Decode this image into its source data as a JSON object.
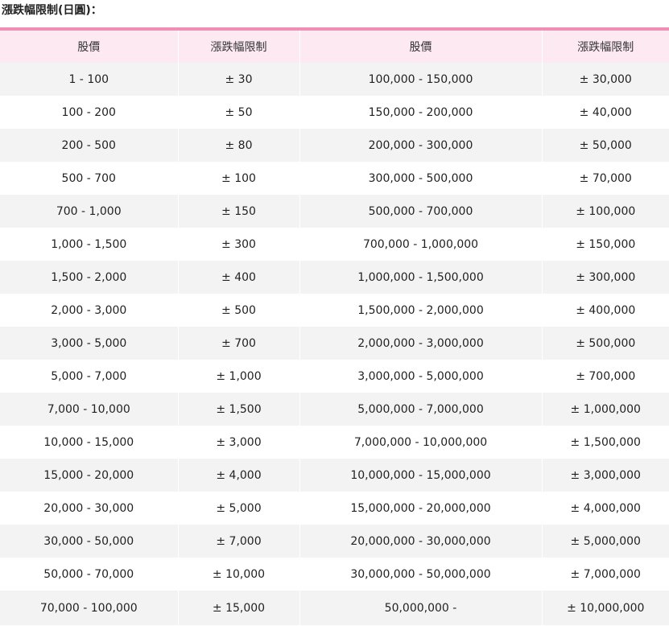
{
  "page_title": "漲跌幅限制(日圓)：",
  "table": {
    "headers": [
      "股價",
      "漲跌幅限制",
      "股價",
      "漲跌幅限制"
    ],
    "rows": [
      [
        "1 - 100",
        "± 30",
        "100,000 - 150,000",
        "± 30,000"
      ],
      [
        "100 - 200",
        "± 50",
        "150,000 - 200,000",
        "± 40,000"
      ],
      [
        "200 - 500",
        "± 80",
        "200,000 - 300,000",
        "± 50,000"
      ],
      [
        "500 - 700",
        "± 100",
        "300,000 - 500,000",
        "± 70,000"
      ],
      [
        "700 - 1,000",
        "± 150",
        "500,000 - 700,000",
        "± 100,000"
      ],
      [
        "1,000 - 1,500",
        "± 300",
        "700,000 - 1,000,000",
        "± 150,000"
      ],
      [
        "1,500 - 2,000",
        "± 400",
        "1,000,000 - 1,500,000",
        "± 300,000"
      ],
      [
        "2,000 - 3,000",
        "± 500",
        "1,500,000 - 2,000,000",
        "± 400,000"
      ],
      [
        "3,000 - 5,000",
        "± 700",
        "2,000,000 - 3,000,000",
        "± 500,000"
      ],
      [
        "5,000 - 7,000",
        "± 1,000",
        "3,000,000 - 5,000,000",
        "± 700,000"
      ],
      [
        "7,000 - 10,000",
        "± 1,500",
        "5,000,000 - 7,000,000",
        "± 1,000,000"
      ],
      [
        "10,000 - 15,000",
        "± 3,000",
        "7,000,000 - 10,000,000",
        "± 1,500,000"
      ],
      [
        "15,000 - 20,000",
        "± 4,000",
        "10,000,000 - 15,000,000",
        "± 3,000,000"
      ],
      [
        "20,000 - 30,000",
        "± 5,000",
        "15,000,000 - 20,000,000",
        "± 4,000,000"
      ],
      [
        "30,000 - 50,000",
        "± 7,000",
        "20,000,000 - 30,000,000",
        "± 5,000,000"
      ],
      [
        "50,000 - 70,000",
        "± 10,000",
        "30,000,000 - 50,000,000",
        "± 7,000,000"
      ],
      [
        "70,000 - 100,000",
        "± 15,000",
        "50,000,000 -",
        "± 10,000,000"
      ]
    ]
  },
  "colors": {
    "accent_rule": "#ee8fb5",
    "header_bg": "#fce9f1",
    "row_stripe": "#f3f3f3"
  }
}
